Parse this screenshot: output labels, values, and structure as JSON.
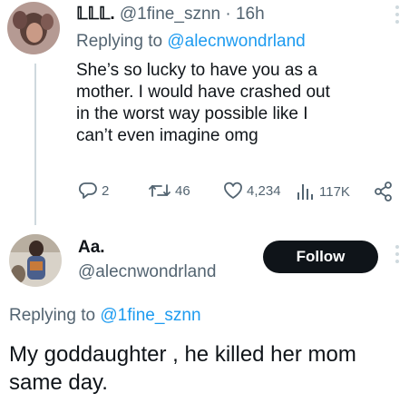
{
  "tweet1": {
    "display_name": "𝕃𝕃𝕃.",
    "handle": "@1fine_sznn",
    "separator": "·",
    "time": "16h",
    "replying_prefix": "Replying to",
    "replying_to": "@alecnwondrland",
    "body": "She’s so lucky to have you as a mother. I would have crashed out in the worst way possible like I can’t even imagine omg",
    "actions": {
      "replies": "2",
      "retweets": "46",
      "likes": "4,234",
      "views": "117K"
    },
    "icons": [
      "reply-icon",
      "retweet-icon",
      "heart-icon",
      "views-icon",
      "share-icon"
    ]
  },
  "tweet2": {
    "display_name": "Aa.",
    "handle": "@alecnwondrland",
    "follow_label": "Follow",
    "replying_prefix": "Replying to",
    "replying_to": "@1fine_sznn",
    "body": "My goddaughter , he killed her mom same day."
  },
  "colors": {
    "link": "#1d9bf0",
    "muted": "#536471",
    "text": "#0f1419",
    "follow_bg": "#0f1419"
  }
}
